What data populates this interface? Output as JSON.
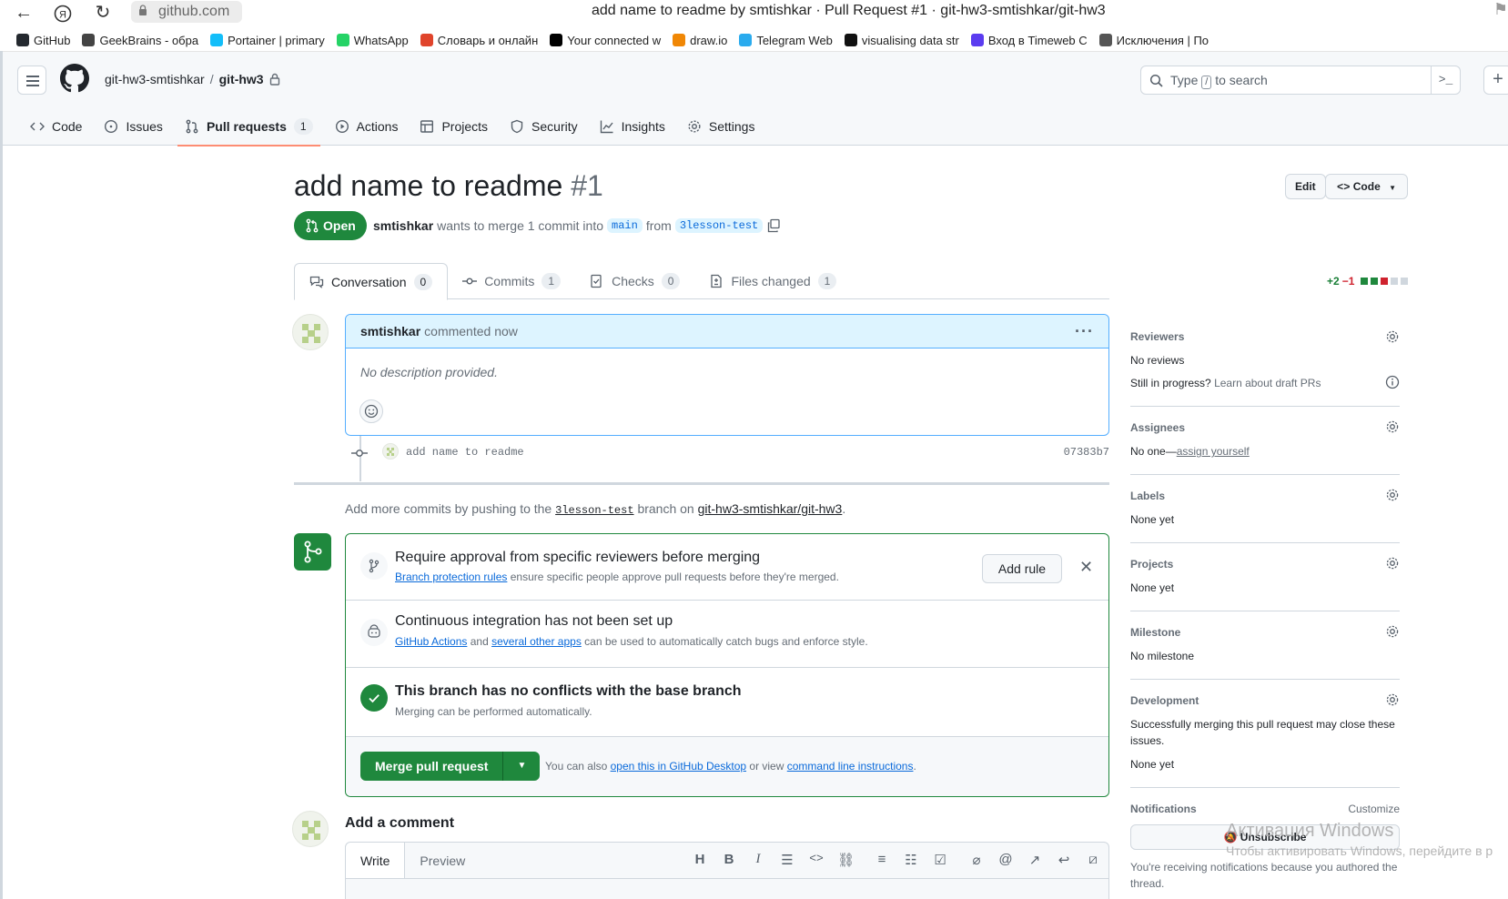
{
  "browser": {
    "address": "github.com",
    "tab_title": "add name to readme by smtishkar · Pull Request #1 · git-hw3-smtishkar/git-hw3",
    "bookmarks": [
      {
        "label": "GitHub",
        "color": "#24292f"
      },
      {
        "label": "GeekBrains - обра",
        "color": "#444444"
      },
      {
        "label": "Portainer | primary",
        "color": "#13bef9"
      },
      {
        "label": "WhatsApp",
        "color": "#25d366"
      },
      {
        "label": "Словарь и онлайн",
        "color": "#e0442b"
      },
      {
        "label": "Your connected w",
        "color": "#000000"
      },
      {
        "label": "draw.io",
        "color": "#f08705"
      },
      {
        "label": "Telegram Web",
        "color": "#2aabee"
      },
      {
        "label": "visualising data str",
        "color": "#111111"
      },
      {
        "label": "Вход в Timeweb C",
        "color": "#5b3cf0"
      },
      {
        "label": "Исключения | По",
        "color": "#555555"
      }
    ]
  },
  "header": {
    "owner": "git-hw3-smtishkar",
    "repo": "git-hw3",
    "search_prefix": "Type",
    "search_key": "/",
    "search_suffix": "to search",
    "tabs": [
      {
        "label": "Code",
        "icon": "code-icon"
      },
      {
        "label": "Issues",
        "icon": "issue-icon"
      },
      {
        "label": "Pull requests",
        "icon": "pull-request-icon",
        "count": "1",
        "active": true
      },
      {
        "label": "Actions",
        "icon": "play-icon"
      },
      {
        "label": "Projects",
        "icon": "table-icon"
      },
      {
        "label": "Security",
        "icon": "shield-icon"
      },
      {
        "label": "Insights",
        "icon": "graph-icon"
      },
      {
        "label": "Settings",
        "icon": "gear-icon"
      }
    ]
  },
  "pr": {
    "title": "add name to readme",
    "number": "#1",
    "edit_label": "Edit",
    "code_label": "Code",
    "state": "Open",
    "author": "smtishkar",
    "merge_text": "wants to merge 1 commit into",
    "base": "main",
    "from_text": "from",
    "head": "3lesson-test",
    "tabs": [
      {
        "label": "Conversation",
        "count": "0"
      },
      {
        "label": "Commits",
        "count": "1"
      },
      {
        "label": "Checks",
        "count": "0"
      },
      {
        "label": "Files changed",
        "count": "1"
      }
    ],
    "additions": "+2",
    "deletions": "−1"
  },
  "comment": {
    "author": "smtishkar",
    "time": "commented now",
    "body": "No description provided."
  },
  "commit": {
    "message": "add name to readme",
    "sha": "07383b7"
  },
  "push_hint": {
    "prefix": "Add more commits by pushing to the",
    "branch": "3lesson-test",
    "middle": "branch on",
    "repo": "git-hw3-smtishkar/git-hw3",
    "suffix": "."
  },
  "merge": {
    "rule_title": "Require approval from specific reviewers before merging",
    "rule_link": "Branch protection rules",
    "rule_text": "ensure specific people approve pull requests before they're merged.",
    "add_rule": "Add rule",
    "ci_title": "Continuous integration has not been set up",
    "ci_link1": "GitHub Actions",
    "ci_and": "and",
    "ci_link2": "several other apps",
    "ci_text": "can be used to automatically catch bugs and enforce style.",
    "ok_title": "This branch has no conflicts with the base branch",
    "ok_text": "Merging can be performed automatically.",
    "merge_button": "Merge pull request",
    "alt_prefix": "You can also",
    "alt_link1": "open this in GitHub Desktop",
    "alt_mid": "or view",
    "alt_link2": "command line instructions",
    "alt_suffix": "."
  },
  "add_comment": {
    "title": "Add a comment",
    "write_tab": "Write",
    "preview_tab": "Preview"
  },
  "sidebar": {
    "reviewers": {
      "head": "Reviewers",
      "value": "No reviews",
      "draft_q": "Still in progress?",
      "draft_link": "Learn about draft PRs"
    },
    "assignees": {
      "head": "Assignees",
      "prefix": "No one—",
      "link": "assign yourself"
    },
    "labels": {
      "head": "Labels",
      "value": "None yet"
    },
    "projects": {
      "head": "Projects",
      "value": "None yet"
    },
    "milestone": {
      "head": "Milestone",
      "value": "No milestone"
    },
    "development": {
      "head": "Development",
      "text": "Successfully merging this pull request may close these issues.",
      "value": "None yet"
    },
    "notifications": {
      "head": "Notifications",
      "customize": "Customize",
      "button": "Unsubscribe",
      "text": "You're receiving notifications because you authored the thread."
    }
  },
  "os_watermark": {
    "line1": "Активация Windows",
    "line2": "Чтобы активировать Windows, перейдите в р"
  }
}
